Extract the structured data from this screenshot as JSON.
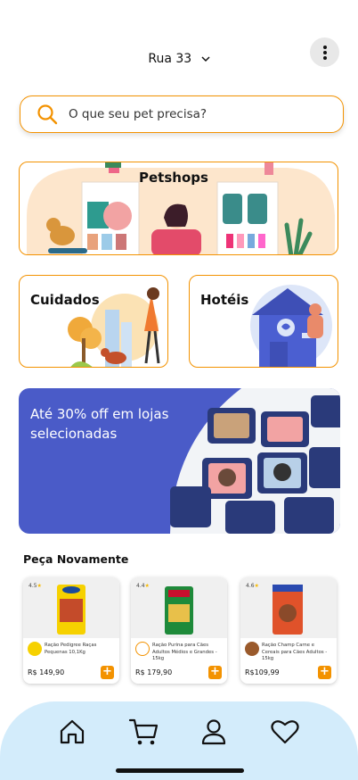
{
  "header": {
    "address": "Rua 33"
  },
  "search": {
    "placeholder": "O que seu pet precisa?"
  },
  "categories": {
    "petshops": "Petshops",
    "cuidados": "Cuidados",
    "hoteis": "Hotéis"
  },
  "promo": {
    "text": "Até 30% off em lojas selecionadas"
  },
  "reorder": {
    "title": "Peça Novamente",
    "products": [
      {
        "rating": "4.5",
        "name": "Ração Pedigree Raças Pequenas 10,1Kg",
        "price": "R$ 149,90",
        "brand_color": "#f6d100"
      },
      {
        "rating": "4.4",
        "name": "Ração Purina para Cães Adultos Médios e Grandes - 15kg",
        "price": "R$ 179,90",
        "brand_color": "#f39200"
      },
      {
        "rating": "4.6",
        "name": "Ração Champ Carne e Cereais para Cães Adultos - 15kg",
        "price": "R$109,99",
        "brand_color": "#9a5a2c"
      }
    ]
  },
  "nav": {
    "items": [
      "home-icon",
      "cart-icon",
      "profile-icon",
      "heart-icon"
    ]
  },
  "colors": {
    "accent": "#f39200",
    "promo_bg": "#4a5bc8",
    "nav_bg": "#d3ecfb"
  }
}
